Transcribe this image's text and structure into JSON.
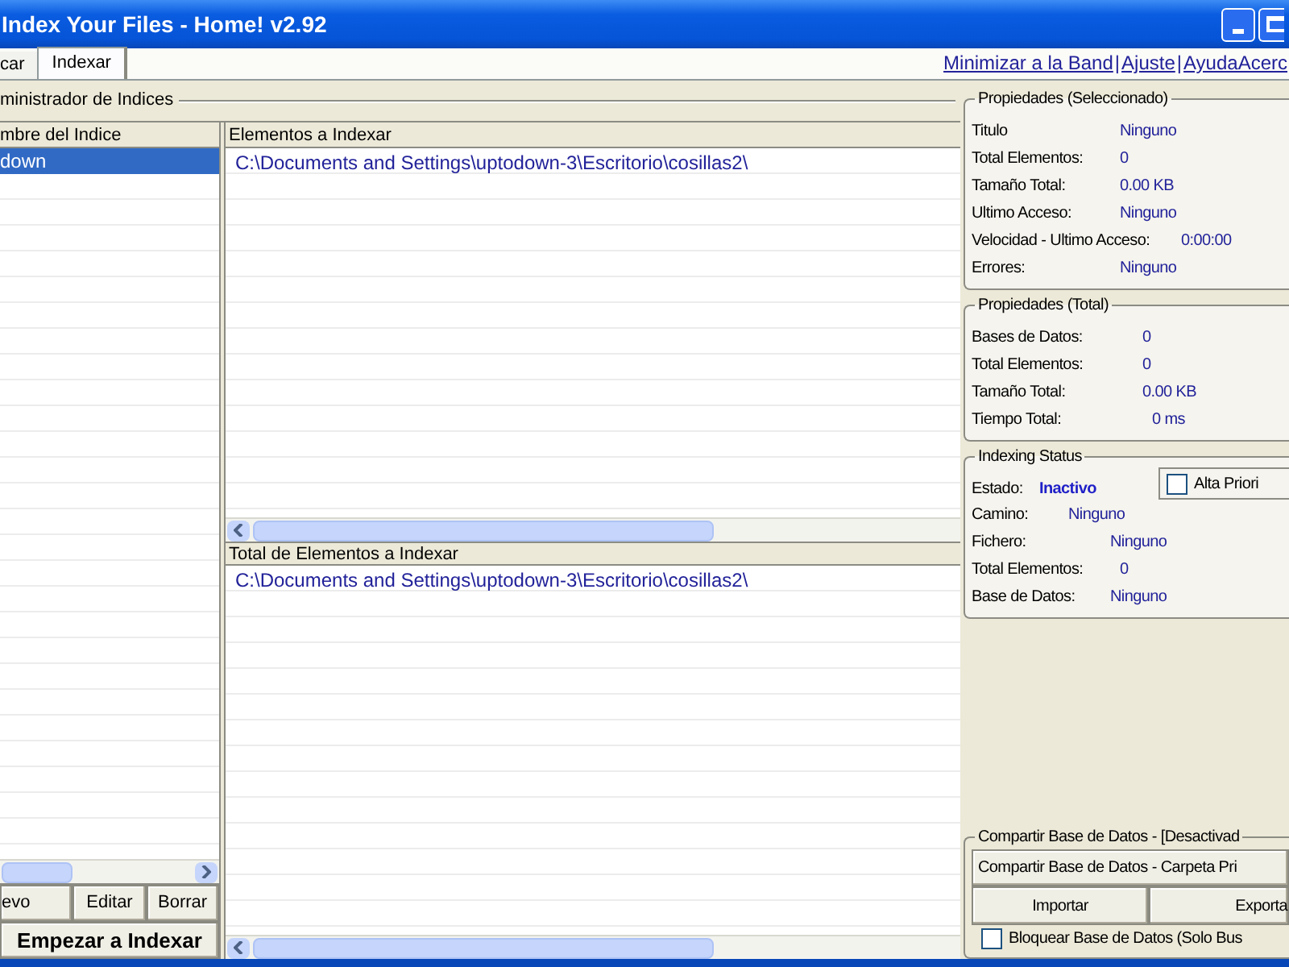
{
  "window": {
    "title": "Index Your Files - Home! v2.92"
  },
  "tabs": [
    {
      "label": "car",
      "selected": false
    },
    {
      "label": "Indexar",
      "selected": true
    }
  ],
  "links": [
    {
      "kind": "link",
      "label": "Minimizar a la Band"
    },
    {
      "kind": "separator",
      "label": "|"
    },
    {
      "kind": "link",
      "label": "Ajuste"
    },
    {
      "kind": "separator",
      "label": "|"
    },
    {
      "kind": "link",
      "label": "AyudaAcerc"
    }
  ],
  "index_manager": {
    "title": "ministrador de Indices",
    "column": "mbre del Indice",
    "rows": [
      {
        "name": "down",
        "selected": true
      }
    ],
    "buttons": [
      "evo",
      "Editar",
      "Borrar"
    ],
    "start_button": "Empezar a Indexar"
  },
  "elements": {
    "header": "Elementos a Indexar",
    "rows": [
      "C:\\Documents and Settings\\uptodown-3\\Escritorio\\cosillas2\\"
    ]
  },
  "total_elements": {
    "header": "Total de Elementos a Indexar",
    "rows": [
      "C:\\Documents and Settings\\uptodown-3\\Escritorio\\cosillas2\\"
    ]
  },
  "properties_selected": {
    "title": "Propiedades (Seleccionado)",
    "fields": [
      {
        "label": "Titulo",
        "value": "Ninguno"
      },
      {
        "label": "Total Elementos:",
        "value": "0"
      },
      {
        "label": "Tamaño Total:",
        "value": "0.00 KB"
      },
      {
        "label": "Ultimo Acceso:",
        "value": "Ninguno"
      },
      {
        "label": "Velocidad - Ultimo Acceso:",
        "value": "0:00:00"
      },
      {
        "label": "Errores:",
        "value": "Ninguno"
      }
    ]
  },
  "properties_total": {
    "title": "Propiedades (Total)",
    "fields": [
      {
        "label": "Bases de Datos:",
        "value": "0"
      },
      {
        "label": "Total Elementos:",
        "value": "0"
      },
      {
        "label": "Tamaño Total:",
        "value": "0.00 KB"
      },
      {
        "label": "Tiempo Total:",
        "value": "0 ms"
      }
    ]
  },
  "indexing_status": {
    "title": "Indexing Status",
    "state_label": "Estado:",
    "state_value": "Inactivo",
    "high_priority": {
      "label": "Alta Priori",
      "checked": false
    },
    "fields": [
      {
        "label": "Camino:",
        "value": "Ninguno"
      },
      {
        "label": "Fichero:",
        "value": "Ninguno"
      },
      {
        "label": "Total Elementos:",
        "value": "0"
      },
      {
        "label": "Base de Datos:",
        "value": "Ninguno"
      }
    ]
  },
  "share": {
    "title": "Compartir Base de Datos - [Desactivad",
    "share_button": "Compartir Base de Datos - Carpeta Pri",
    "import_button": "Importar",
    "export_button": "Exporta",
    "lock": {
      "label": "Bloquear Base de Datos (Solo Bus",
      "checked": false
    }
  }
}
